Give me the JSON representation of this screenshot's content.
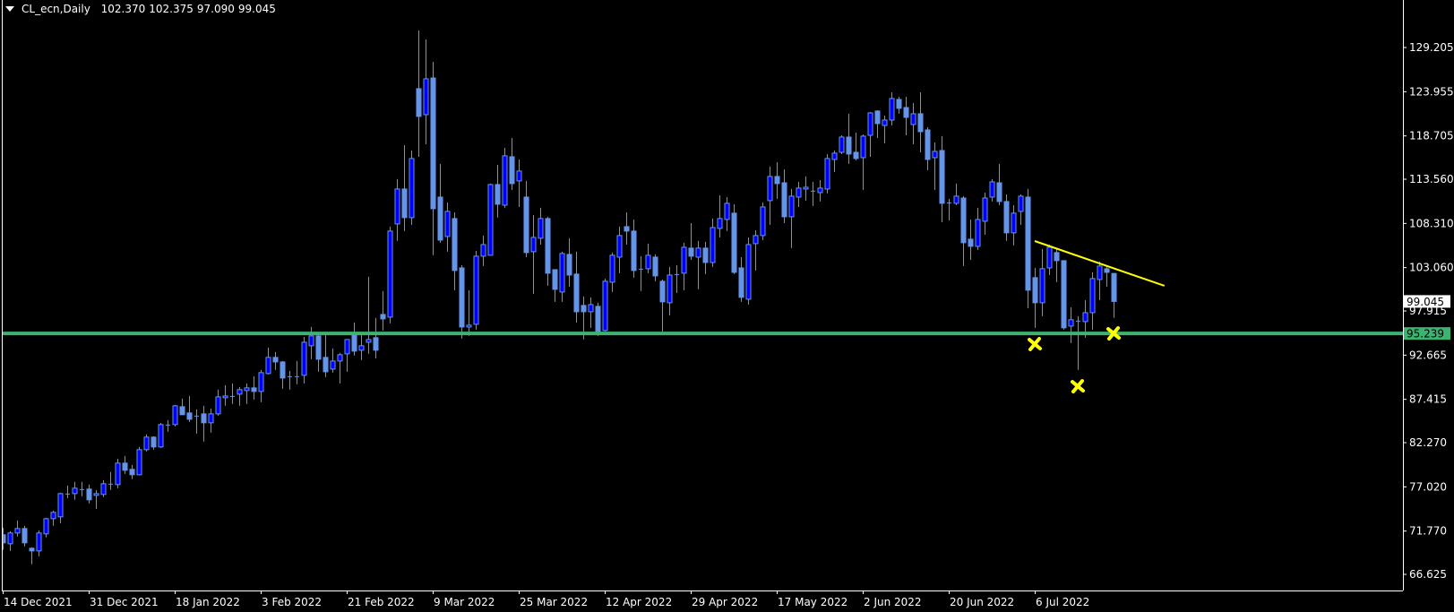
{
  "header": {
    "symbol": "CL_ecn,Daily",
    "open": "102.370",
    "high": "102.375",
    "low": "97.090",
    "close": "99.045"
  },
  "colors": {
    "background": "#000000",
    "bull_fill": "#0000ff",
    "bear_fill": "#6495ed",
    "wick": "#6495ed",
    "axis": "#ffffff",
    "support_line": "#3cb371",
    "trendline": "#ffff00",
    "marker": "#ffff00"
  },
  "chart_data": {
    "type": "candlestick",
    "title": "CL_ecn,Daily",
    "ylim": [
      64.71,
      134.85
    ],
    "grid": false,
    "y_ticks": [
      "129.205",
      "123.955",
      "118.705",
      "113.560",
      "108.310",
      "103.060",
      "97.915",
      "92.665",
      "87.415",
      "82.270",
      "77.020",
      "71.770",
      "66.625"
    ],
    "x_ticks": [
      {
        "index": 0,
        "label": "14 Dec 2021"
      },
      {
        "index": 12,
        "label": "31 Dec 2021"
      },
      {
        "index": 24,
        "label": "18 Jan 2022"
      },
      {
        "index": 36,
        "label": "3 Feb 2022"
      },
      {
        "index": 48,
        "label": "21 Feb 2022"
      },
      {
        "index": 60,
        "label": "9 Mar 2022"
      },
      {
        "index": 72,
        "label": "25 Mar 2022"
      },
      {
        "index": 84,
        "label": "12 Apr 2022"
      },
      {
        "index": 96,
        "label": "29 Apr 2022"
      },
      {
        "index": 108,
        "label": "17 May 2022"
      },
      {
        "index": 120,
        "label": "2 Jun 2022"
      },
      {
        "index": 132,
        "label": "20 Jun 2022"
      },
      {
        "index": 144,
        "label": "6 Jul 2022"
      }
    ],
    "ohlc": [
      [
        71.33,
        72.18,
        69.52,
        70.37
      ],
      [
        70.26,
        71.75,
        69.41,
        71.54
      ],
      [
        71.54,
        73.03,
        71.12,
        72.07
      ],
      [
        72.07,
        72.39,
        69.95,
        70.37
      ],
      [
        69.73,
        69.84,
        67.82,
        69.41
      ],
      [
        69.41,
        71.86,
        68.77,
        71.54
      ],
      [
        71.44,
        73.35,
        71.01,
        73.24
      ],
      [
        73.24,
        74.2,
        72.39,
        73.99
      ],
      [
        73.46,
        76.33,
        72.71,
        76.22
      ],
      [
        76.22,
        77.18,
        75.69,
        76.2
      ],
      [
        76.22,
        77.61,
        75.48,
        76.86
      ],
      [
        76.76,
        77.61,
        75.9,
        76.74
      ],
      [
        76.76,
        77.29,
        75.05,
        75.48
      ],
      [
        76.01,
        76.65,
        74.41,
        76.22
      ],
      [
        76.12,
        77.82,
        75.8,
        77.39
      ],
      [
        77.39,
        78.78,
        76.65,
        77.4
      ],
      [
        77.29,
        80.37,
        76.86,
        79.84
      ],
      [
        79.84,
        80.69,
        78.56,
        78.99
      ],
      [
        79.1,
        79.63,
        77.93,
        78.46
      ],
      [
        78.46,
        81.76,
        78.4,
        81.44
      ],
      [
        81.44,
        83.25,
        81.22,
        82.93
      ],
      [
        82.93,
        83.03,
        81.44,
        81.76
      ],
      [
        81.76,
        84.63,
        81.65,
        84.42
      ],
      [
        84.42,
        84.95,
        83.56,
        84.4
      ],
      [
        84.42,
        86.76,
        84.2,
        86.65
      ],
      [
        86.54,
        87.5,
        85.59,
        85.59
      ],
      [
        85.8,
        87.82,
        84.73,
        85.05
      ],
      [
        85.48,
        86.22,
        83.35,
        85.47
      ],
      [
        85.69,
        86.65,
        82.39,
        84.63
      ],
      [
        84.63,
        86.33,
        83.46,
        85.69
      ],
      [
        85.69,
        88.57,
        85.48,
        87.71
      ],
      [
        87.61,
        89.1,
        86.65,
        87.82
      ],
      [
        87.82,
        89.31,
        86.86,
        87.8
      ],
      [
        88.03,
        88.89,
        86.65,
        88.57
      ],
      [
        88.46,
        89.31,
        86.86,
        88.78
      ],
      [
        88.78,
        90.16,
        87.39,
        88.35
      ],
      [
        88.35,
        90.9,
        87.08,
        90.59
      ],
      [
        90.48,
        93.57,
        90.38,
        92.4
      ],
      [
        92.4,
        93.03,
        90.9,
        91.86
      ],
      [
        91.86,
        91.97,
        88.67,
        89.95
      ],
      [
        90.16,
        90.8,
        88.57,
        90.15
      ],
      [
        90.16,
        91.97,
        89.2,
        90.17
      ],
      [
        90.27,
        94.84,
        89.31,
        94.2
      ],
      [
        93.78,
        96.01,
        92.18,
        94.95
      ],
      [
        94.95,
        95.27,
        90.69,
        92.18
      ],
      [
        92.4,
        95.16,
        90.06,
        90.69
      ],
      [
        91.01,
        93.46,
        90.59,
        91.97
      ],
      [
        91.97,
        92.93,
        89.31,
        92.72
      ],
      [
        92.82,
        94.52,
        90.69,
        94.52
      ],
      [
        95.27,
        96.55,
        92.61,
        93.14
      ],
      [
        93.25,
        95.27,
        92.08,
        93.78
      ],
      [
        94.2,
        101.97,
        92.82,
        94.52
      ],
      [
        94.74,
        97.08,
        92.29,
        93.25
      ],
      [
        97.5,
        100.27,
        95.59,
        96.97
      ],
      [
        97.18,
        107.93,
        96.44,
        107.4
      ],
      [
        108.25,
        113.57,
        106.23,
        112.4
      ],
      [
        112.4,
        117.61,
        107.4,
        109.0
      ],
      [
        109.0,
        116.97,
        108.14,
        116.02
      ],
      [
        124.32,
        131.23,
        116.23,
        121.02
      ],
      [
        121.23,
        130.17,
        117.72,
        125.49
      ],
      [
        125.59,
        127.51,
        104.53,
        110.06
      ],
      [
        111.44,
        115.38,
        106.02,
        106.33
      ],
      [
        106.76,
        110.8,
        104.95,
        109.74
      ],
      [
        108.89,
        109.63,
        100.38,
        102.72
      ],
      [
        103.03,
        103.35,
        94.63,
        96.01
      ],
      [
        96.01,
        100.38,
        94.95,
        96.23
      ],
      [
        96.33,
        105.06,
        95.7,
        104.42
      ],
      [
        104.42,
        106.87,
        103.25,
        105.8
      ],
      [
        104.53,
        113.04,
        104.5,
        112.93
      ],
      [
        112.93,
        115.27,
        109.0,
        110.59
      ],
      [
        110.48,
        117.29,
        110.17,
        116.34
      ],
      [
        116.23,
        118.46,
        112.29,
        113.04
      ],
      [
        113.36,
        115.91,
        110.27,
        114.53
      ],
      [
        111.44,
        113.36,
        104.31,
        104.85
      ],
      [
        104.95,
        109.31,
        99.95,
        106.65
      ],
      [
        106.55,
        110.17,
        105.8,
        108.89
      ],
      [
        108.89,
        109.1,
        100.91,
        102.4
      ],
      [
        102.82,
        102.8,
        99.0,
        100.48
      ],
      [
        100.16,
        104.95,
        99.0,
        104.74
      ],
      [
        104.63,
        106.55,
        100.8,
        102.18
      ],
      [
        102.29,
        104.95,
        96.55,
        97.82
      ],
      [
        98.57,
        99.63,
        94.52,
        97.82
      ],
      [
        97.82,
        99.53,
        95.91,
        98.67
      ],
      [
        98.46,
        98.89,
        94.95,
        95.48
      ],
      [
        95.59,
        101.76,
        95.48,
        101.44
      ],
      [
        101.33,
        104.85,
        100.16,
        104.53
      ],
      [
        104.31,
        107.93,
        102.4,
        106.87
      ],
      [
        107.93,
        109.63,
        105.8,
        107.4
      ],
      [
        107.4,
        108.78,
        101.87,
        102.72
      ],
      [
        102.93,
        104.42,
        100.27,
        102.9
      ],
      [
        102.93,
        105.91,
        102.4,
        104.53
      ],
      [
        104.31,
        104.63,
        101.44,
        102.08
      ],
      [
        101.44,
        101.65,
        95.48,
        99.0
      ],
      [
        98.89,
        103.14,
        97.4,
        102.18
      ],
      [
        102.29,
        103.35,
        100.06,
        102.3
      ],
      [
        102.4,
        106.02,
        100.38,
        105.48
      ],
      [
        105.38,
        108.35,
        103.99,
        104.42
      ],
      [
        104.31,
        106.23,
        100.48,
        105.38
      ],
      [
        105.38,
        106.12,
        102.29,
        103.67
      ],
      [
        103.67,
        108.89,
        103.14,
        107.82
      ],
      [
        107.72,
        111.65,
        106.65,
        108.89
      ],
      [
        108.78,
        111.44,
        107.4,
        110.7
      ],
      [
        109.53,
        110.59,
        102.29,
        102.5
      ],
      [
        103.03,
        104.31,
        99.0,
        99.53
      ],
      [
        99.31,
        106.65,
        98.67,
        105.8
      ],
      [
        105.91,
        107.5,
        102.72,
        106.87
      ],
      [
        106.87,
        110.8,
        106.33,
        110.27
      ],
      [
        111.02,
        115.06,
        108.14,
        113.89
      ],
      [
        113.89,
        115.59,
        111.23,
        113.04
      ],
      [
        113.14,
        114.74,
        108.35,
        109.1
      ],
      [
        109.1,
        112.4,
        105.38,
        111.55
      ],
      [
        111.44,
        113.25,
        110.27,
        112.51
      ],
      [
        112.4,
        113.89,
        111.02,
        112.61
      ],
      [
        112.19,
        113.25,
        110.38,
        112.2
      ],
      [
        111.97,
        113.46,
        110.91,
        112.51
      ],
      [
        112.4,
        116.55,
        111.87,
        116.02
      ],
      [
        115.91,
        116.97,
        114.42,
        116.66
      ],
      [
        116.76,
        118.78,
        116.55,
        118.57
      ],
      [
        118.57,
        121.34,
        115.38,
        116.55
      ],
      [
        116.76,
        119.1,
        115.8,
        116.02
      ],
      [
        116.12,
        118.89,
        112.29,
        118.68
      ],
      [
        118.78,
        121.55,
        116.23,
        121.44
      ],
      [
        121.66,
        121.76,
        118.46,
        120.17
      ],
      [
        119.95,
        121.12,
        117.83,
        120.59
      ],
      [
        120.59,
        123.89,
        119.95,
        123.15
      ],
      [
        123.04,
        123.36,
        121.34,
        121.98
      ],
      [
        122.08,
        123.36,
        118.78,
        120.91
      ],
      [
        120.06,
        122.61,
        117.72,
        121.34
      ],
      [
        121.34,
        123.89,
        116.76,
        119.21
      ],
      [
        119.42,
        119.74,
        114.63,
        115.91
      ],
      [
        116.12,
        117.93,
        112.29,
        116.87
      ],
      [
        116.97,
        118.68,
        108.46,
        110.7
      ],
      [
        110.8,
        111.23,
        108.67,
        110.79
      ],
      [
        110.7,
        113.04,
        110.48,
        111.55
      ],
      [
        111.33,
        111.55,
        103.25,
        106.02
      ],
      [
        106.44,
        108.78,
        103.99,
        105.59
      ],
      [
        105.59,
        110.17,
        105.16,
        108.78
      ],
      [
        108.57,
        111.97,
        106.97,
        111.33
      ],
      [
        111.44,
        113.57,
        110.91,
        113.25
      ],
      [
        113.14,
        115.38,
        110.48,
        110.91
      ],
      [
        110.91,
        111.76,
        106.23,
        107.19
      ],
      [
        107.19,
        110.48,
        105.7,
        109.53
      ],
      [
        109.74,
        111.76,
        108.14,
        111.55
      ],
      [
        111.44,
        112.4,
        98.25,
        100.38
      ],
      [
        101.87,
        103.03,
        95.91,
        98.89
      ],
      [
        98.89,
        105.27,
        97.29,
        102.93
      ],
      [
        103.03,
        105.8,
        102.18,
        105.48
      ],
      [
        104.85,
        105.27,
        101.33,
        103.89
      ],
      [
        103.89,
        103.9,
        95.7,
        95.91
      ],
      [
        96.12,
        98.36,
        94.1,
        96.87
      ],
      [
        96.76,
        97.29,
        90.91,
        96.75
      ],
      [
        96.65,
        99.21,
        94.74,
        97.71
      ],
      [
        97.71,
        102.5,
        95.7,
        101.76
      ],
      [
        101.65,
        103.78,
        99.21,
        103.25
      ],
      [
        102.93,
        103.25,
        100.8,
        102.5
      ],
      [
        102.37,
        102.375,
        97.09,
        99.045
      ]
    ],
    "horizontal_line": {
      "price": 95.239,
      "label": "95.239"
    },
    "current_price": {
      "price": 99.045,
      "label": "99.045"
    },
    "trendline": {
      "start": {
        "index": 144,
        "price": 106.22
      },
      "end": {
        "index": 162.1,
        "price": 100.9
      }
    },
    "markers": [
      {
        "index": 144,
        "price": 93.98,
        "shape": "x"
      },
      {
        "index": 150,
        "price": 88.97,
        "shape": "x"
      },
      {
        "index": 155,
        "price": 95.25,
        "shape": "x"
      }
    ]
  }
}
